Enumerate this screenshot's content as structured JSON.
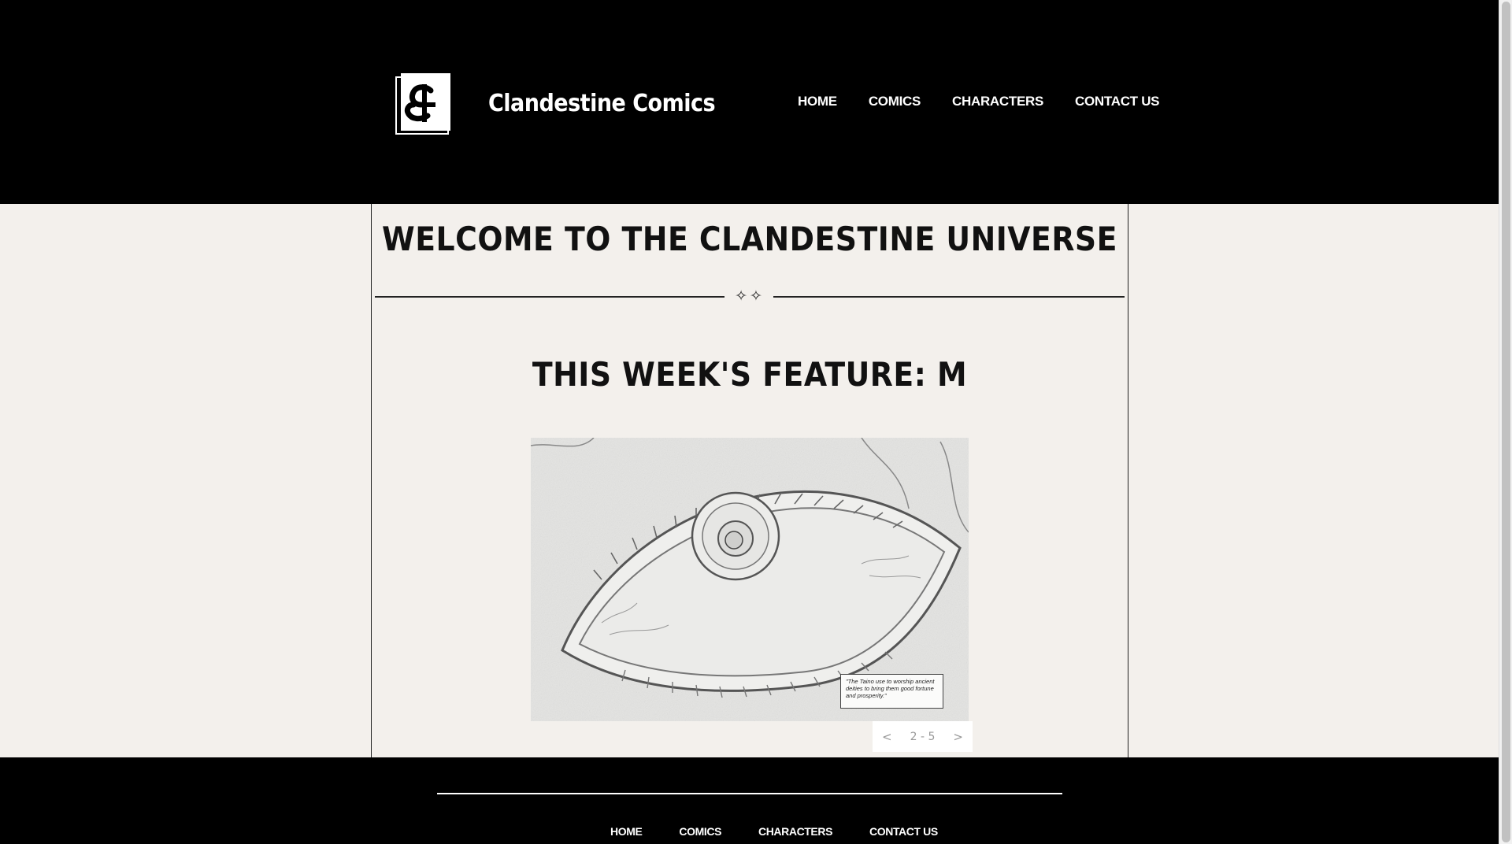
{
  "header": {
    "site_title": "Clandestine Comics",
    "logo_icon": "clandestine-cc-logo",
    "nav": [
      "HOME",
      "COMICS",
      "CHARACTERS",
      "CONTACT US"
    ]
  },
  "main": {
    "welcome_heading": "WELCOME TO THE CLANDESTINE UNIVERSE",
    "divider_ornament": "✧✧",
    "feature_heading": "THIS WEEK'S FEATURE: M",
    "slideshow": {
      "image_subject": "pencil sketch of an eye",
      "caption": "\"The Taino use to worship ancient deities to bring them good fortune and prosperity.\"",
      "prev_label": "<",
      "counter": "2 - 5",
      "next_label": ">"
    }
  },
  "footer": {
    "nav": [
      "HOME",
      "COMICS",
      "CHARACTERS",
      "CONTACT US"
    ]
  },
  "colors": {
    "header_bg": "#000000",
    "page_bg": "#f3f0ec",
    "text": "#111111",
    "nav_text": "#ffffff"
  }
}
